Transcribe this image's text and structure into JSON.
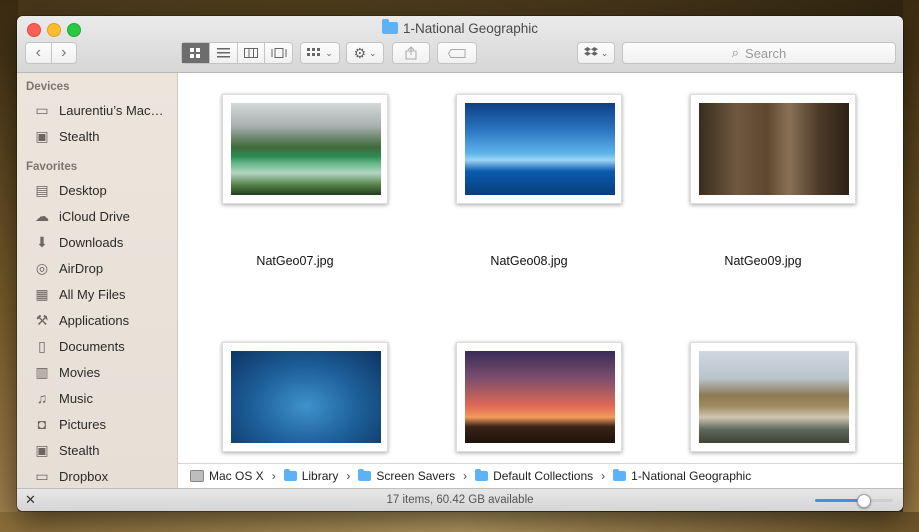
{
  "window": {
    "title": "1-National Geographic"
  },
  "toolbar": {
    "back": "‹",
    "forward": "›",
    "search_placeholder": "Search"
  },
  "sidebar": {
    "devices_header": "Devices",
    "devices": [
      {
        "label": "Laurentiu’s Mac…",
        "icon": "laptop-icon"
      },
      {
        "label": "Stealth",
        "icon": "drive-icon"
      }
    ],
    "favorites_header": "Favorites",
    "favorites": [
      {
        "label": "Desktop",
        "icon": "desktop-icon"
      },
      {
        "label": "iCloud Drive",
        "icon": "cloud-icon"
      },
      {
        "label": "Downloads",
        "icon": "downloads-icon"
      },
      {
        "label": "AirDrop",
        "icon": "airdrop-icon"
      },
      {
        "label": "All My Files",
        "icon": "all-files-icon"
      },
      {
        "label": "Applications",
        "icon": "applications-icon"
      },
      {
        "label": "Documents",
        "icon": "documents-icon"
      },
      {
        "label": "Movies",
        "icon": "movies-icon"
      },
      {
        "label": "Music",
        "icon": "music-icon"
      },
      {
        "label": "Pictures",
        "icon": "pictures-icon"
      },
      {
        "label": "Stealth",
        "icon": "drive-icon"
      },
      {
        "label": "Dropbox",
        "icon": "folder-icon"
      }
    ]
  },
  "files": [
    {
      "name": "NatGeo07.jpg"
    },
    {
      "name": "NatGeo08.jpg"
    },
    {
      "name": "NatGeo09.jpg"
    },
    {
      "name": ""
    },
    {
      "name": ""
    },
    {
      "name": ""
    }
  ],
  "pathbar": [
    "Mac OS X",
    "Library",
    "Screen Savers",
    "Default Collections",
    "1-National Geographic"
  ],
  "status": {
    "text": "17 items, 60.42 GB available",
    "icon_size_level": 0.62
  }
}
